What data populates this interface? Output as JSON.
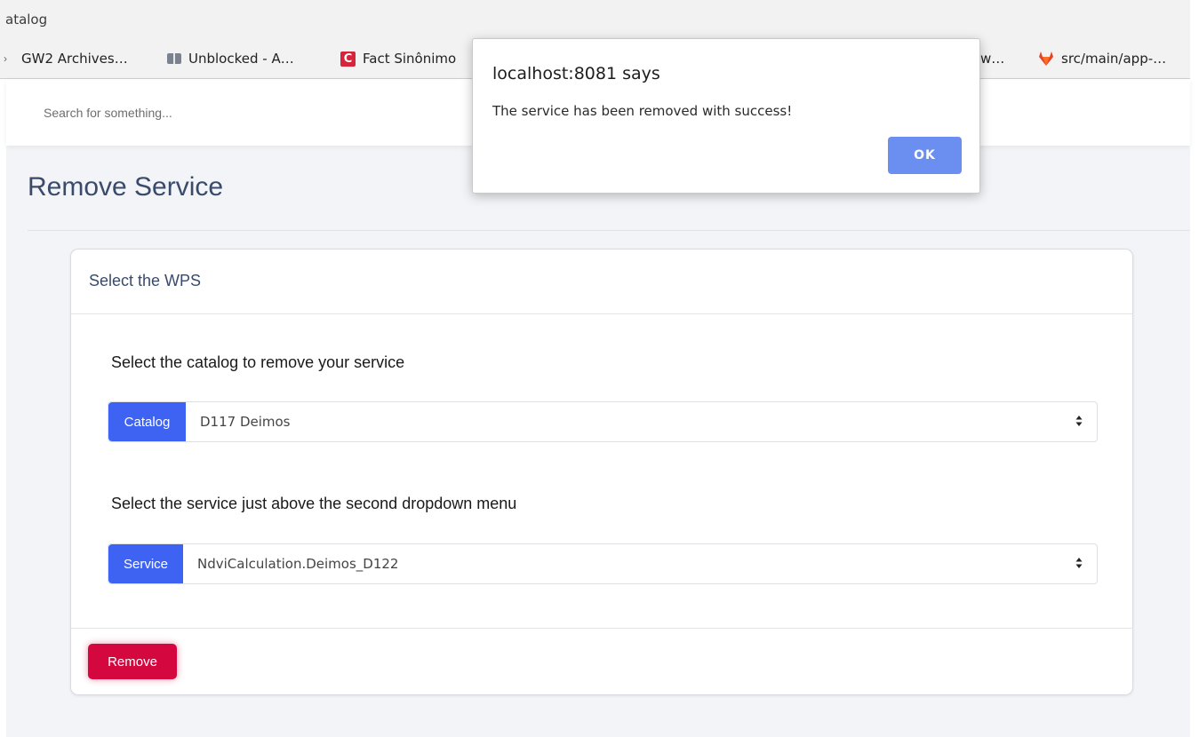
{
  "browser": {
    "tab_title": "atalog",
    "bookmarks": [
      {
        "label": "GW2 Archives…",
        "icon": "bookmark-chevron-icon"
      },
      {
        "label": "Unblocked - A…",
        "icon": "book-icon"
      },
      {
        "label": "Fact Sinônimo",
        "icon": "c-logo-icon"
      },
      {
        "label": "w…",
        "icon": ""
      },
      {
        "label": "src/main/app-…",
        "icon": "gitlab-icon"
      }
    ]
  },
  "search": {
    "placeholder": "Search for something..."
  },
  "page": {
    "title": "Remove Service"
  },
  "card": {
    "header": "Select the WPS",
    "catalog_section_label": "Select the catalog to remove your service",
    "catalog_addon": "Catalog",
    "catalog_value": "D117 Deimos",
    "service_section_label": "Select the service just above the second dropdown menu",
    "service_addon": "Service",
    "service_value": "NdviCalculation.Deimos_D122",
    "remove_label": "Remove"
  },
  "dialog": {
    "title": "localhost:8081 says",
    "message": "The service has been removed with success!",
    "ok_label": "OK"
  },
  "colors": {
    "primary_addon": "#3e63f2",
    "remove_button": "#d4083f",
    "ok_button": "#6a8ff0",
    "title_text": "#3a4a6b"
  }
}
